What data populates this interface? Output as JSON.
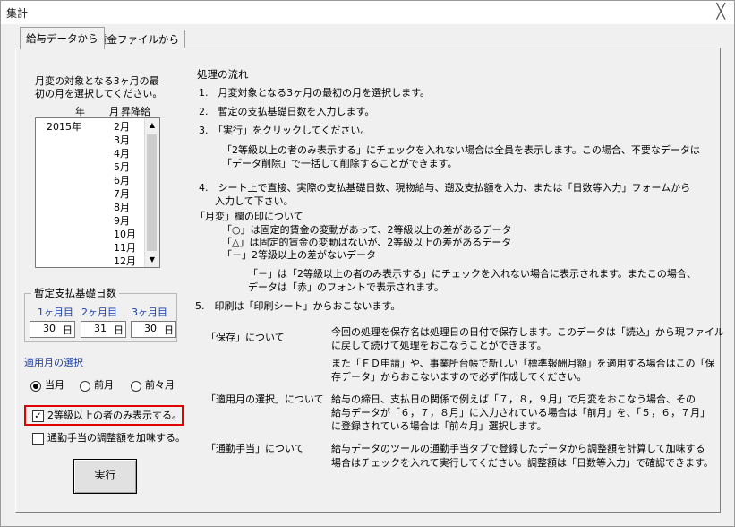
{
  "window": {
    "title": "集計",
    "close_glyph": "╳"
  },
  "tabs": [
    {
      "label": "給与データから"
    },
    {
      "label": "賃金ファイルから"
    }
  ],
  "month_select": {
    "prompt_line1": "月変の対象となる3ヶ月の最",
    "prompt_line2": "初の月を選択してください。",
    "col_year": "年",
    "col_month": "月",
    "col_raise": "昇降給",
    "rows": [
      {
        "year": "2015年",
        "month": "2月"
      },
      {
        "year": "",
        "month": "3月"
      },
      {
        "year": "",
        "month": "4月"
      },
      {
        "year": "",
        "month": "5月"
      },
      {
        "year": "",
        "month": "6月"
      },
      {
        "year": "",
        "month": "7月"
      },
      {
        "year": "",
        "month": "8月"
      },
      {
        "year": "",
        "month": "9月"
      },
      {
        "year": "",
        "month": "10月"
      },
      {
        "year": "",
        "month": "11月"
      },
      {
        "year": "",
        "month": "12月"
      }
    ]
  },
  "base_days": {
    "legend": "暫定支払基礎日数",
    "month1_label": "1ヶ月目",
    "month2_label": "2ヶ月目",
    "month3_label": "3ヶ月目",
    "month1_value": "30",
    "month2_value": "31",
    "month3_value": "30",
    "calendar_glyph": "日"
  },
  "apply_month": {
    "heading": "適用月の選択",
    "options": [
      "当月",
      "前月",
      "前々月"
    ],
    "selected": "当月"
  },
  "checkboxes": {
    "grade2_only": {
      "label": "2等級以上の者のみ表示する。",
      "checked": true
    },
    "commute_adjust": {
      "label": "通勤手当の調整額を加味する。",
      "checked": false
    }
  },
  "run_button": "実行",
  "instructions": {
    "heading": "処理の流れ",
    "step1": "1.　月変対象となる3ヶ月の最初の月を選択します。",
    "step2": "2.　暫定の支払基礎日数を入力します。",
    "step3": "3.　「実行」をクリックしてください。",
    "step3_note1": "「2等級以上の者のみ表示する」にチェックを入れない場合は全員を表示します。この場合、不要なデータは",
    "step3_note2": "「データ削除」で一括して削除することができます。",
    "step4_line1": "4.　シート上で直接、実際の支払基礎日数、現物給与、遡及支払額を入力、または「日数等入力」フォームから",
    "step4_line2": "入力して下さい。",
    "mark_heading": "「月変」欄の印について",
    "mark1": "「○」は固定的賃金の変動があって、2等級以上の差があるデータ",
    "mark2": "「△」は固定的賃金の変動はないが、2等級以上の差があるデータ",
    "mark3": "「－」2等級以上の差がないデータ",
    "mark_note1": "「－」は「2等級以上の者のみ表示する」にチェックを入れない場合に表示されます。またこの場合、",
    "mark_note2": "データは「赤」のフォントで表示されます。",
    "step5": "5.　印刷は「印刷シート」からおこないます。"
  },
  "notes": {
    "save_label": "「保存」について",
    "save_text1": "今回の処理を保存名は処理日の日付で保存します。このデータは「読込」から現ファイル",
    "save_text2": "に戻して続けて処理をおこなうことができます。",
    "save_text3": "また「ＦＤ申請」や、事業所台帳で新しい「標準報酬月額」を適用する場合はこの「保",
    "save_text4": "存データ」からおこないますので必ず作成してください。",
    "apply_label": "「適用月の選択」について",
    "apply_text1": "給与の締日、支払日の関係で例えば「７，８，９月」で月変をおこなう場合、その",
    "apply_text2": "給与データが「６，７，８月」に入力されている場合は「前月」を、「５，６，７月」",
    "apply_text3": "に登録されている場合は「前々月」選択します。",
    "commute_label": "「通勤手当」について",
    "commute_text1": "給与データのツールの通勤手当タブで登録したデータから調整額を計算して加味する",
    "commute_text2": "場合はチェックを入れて実行してください。調整額は「日数等入力」で確認できます。"
  }
}
